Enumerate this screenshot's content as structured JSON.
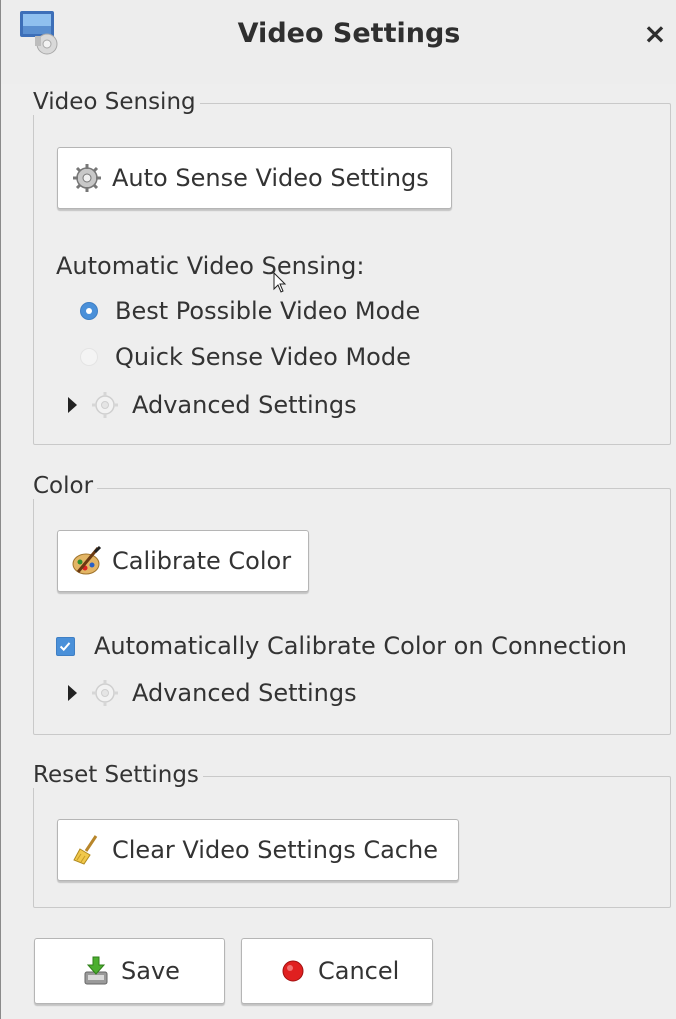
{
  "window": {
    "title": "Video Settings",
    "close_glyph": "×",
    "icon": "app-display-icon"
  },
  "video_sensing": {
    "group_label": "Video Sensing",
    "auto_sense_button": "Auto Sense Video Settings",
    "auto_sense_icon": "sensing-gear-icon",
    "mode_label": "Automatic Video Sensing:",
    "options": [
      {
        "label": "Best Possible Video Mode",
        "selected": true
      },
      {
        "label": "Quick Sense Video Mode",
        "selected": false
      }
    ],
    "advanced_label": "Advanced Settings"
  },
  "color": {
    "group_label": "Color",
    "calibrate_button": "Calibrate Color",
    "calibrate_icon": "palette-icon",
    "auto_calibrate_label": "Automatically Calibrate Color on Connection",
    "auto_calibrate_checked": true,
    "advanced_label": "Advanced Settings"
  },
  "reset": {
    "group_label": "Reset Settings",
    "clear_button": "Clear Video Settings Cache",
    "clear_icon": "broom-icon"
  },
  "footer": {
    "save_label": "Save",
    "save_icon": "save-download-icon",
    "cancel_label": "Cancel",
    "cancel_icon": "red-circle-icon"
  },
  "colors": {
    "accent": "#4a90d9",
    "background": "#eeeeee",
    "cancel_red": "#e02020"
  }
}
